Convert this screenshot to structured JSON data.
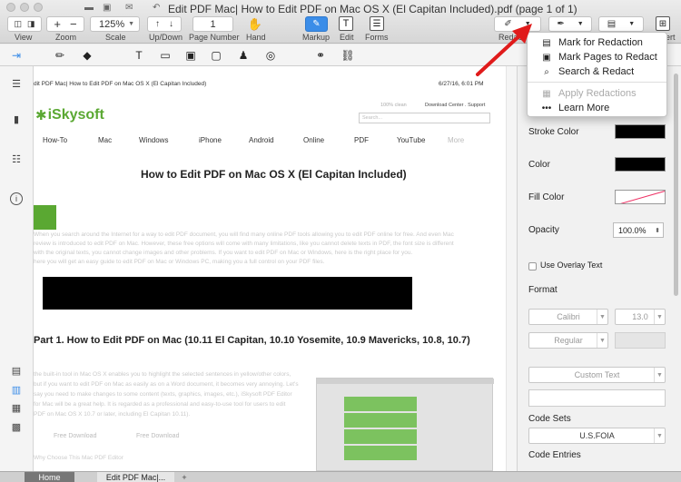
{
  "window": {
    "title": "Edit PDF Mac| How to Edit PDF on Mac OS X (El Capitan Included).pdf (page 1 of 1)"
  },
  "toolbar": {
    "zoom_value": "125%",
    "page_number": "1",
    "labels": {
      "view": "View",
      "zoom": "Zoom",
      "scale": "Scale",
      "updown": "Up/Down",
      "page_number": "Page Number",
      "hand": "Hand",
      "markup": "Markup",
      "edit": "Edit",
      "forms": "Forms",
      "redact": "Redac",
      "insert": "ert"
    }
  },
  "menu": {
    "items": [
      {
        "label": "Mark for Redaction",
        "icon": "mark-redaction-icon",
        "enabled": true
      },
      {
        "label": "Mark Pages to Redact",
        "icon": "mark-pages-icon",
        "enabled": true
      },
      {
        "label": "Search & Redact",
        "icon": "search-redact-icon",
        "enabled": true
      },
      {
        "label": "Apply Redactions",
        "icon": "apply-redactions-icon",
        "enabled": false
      },
      {
        "label": "Learn More",
        "icon": "more-dots-icon",
        "enabled": true
      }
    ]
  },
  "document": {
    "header_left": "dit PDF Mac| How to Edit PDF on Mac OS X (El Capitan Included)",
    "header_right": "6/27/16, 6:01 PM",
    "logo": "iSkysoft",
    "top_links": "Download Center . Support",
    "like_text": "100% clean",
    "search_placeholder": "Search...",
    "nav": [
      "How-To",
      "Mac",
      "Windows",
      "iPhone",
      "Android",
      "Online",
      "PDF",
      "YouTube",
      "More"
    ],
    "heading": "How to Edit PDF on Mac OS X (El Capitan Included)",
    "intro_lines": [
      "When you search around the Internet for a way to edit PDF document, you will find many online PDF tools allowing you to edit PDF online for free. And even Mac",
      "review is introduced to edit PDF on Mac. However, these free options will come with many limitations, like you cannot delete texts in PDF, the font size is different",
      "with the original texts, you cannot change images and other problems. If you want to edit PDF on Mac or Windows, here is the right place for you.",
      "here you will get an easy guide to edit PDF on Mac or Windows PC, making you a full control on your PDF files."
    ],
    "part_heading": "Part 1. How to Edit PDF on Mac (10.11 El Capitan, 10.10 Yosemite, 10.9 Mavericks, 10.8, 10.7)",
    "body_lines": [
      "the built-in tool in Mac OS X enables you to highlight the selected sentences in yellow/other colors,",
      "but if you want to edit PDF on Mac as easily as on a Word document, it becomes very annoying. Let's",
      "say you need to make changes to some content (texts, graphics, images, etc.), iSkysoft PDF Editor",
      "for Mac will be a great help. It is regarded as a professional and easy-to-use tool for users to edit",
      "PDF on Mac OS X 10.7 or later, including El Capitan 10.11)."
    ],
    "free_download_1": "Free Download",
    "free_download_2": "Free Download",
    "why_choose": "Why Choose This Mac PDF Editor"
  },
  "panel": {
    "stroke_color_label": "Stroke Color",
    "color_label": "Color",
    "fill_color_label": "Fill Color",
    "opacity_label": "Opacity",
    "opacity_value": "100.0%",
    "overlay_label": "Use Overlay Text",
    "format_label": "Format",
    "font_value": "Calibri",
    "font_size_value": "13.0",
    "font_style_value": "Regular",
    "custom_text_value": "Custom Text",
    "code_sets_label": "Code Sets",
    "code_sets_value": "U.S.FOIA",
    "code_entries_label": "Code Entries"
  },
  "tabs": {
    "home": "Home",
    "doc": "Edit PDF Mac|...",
    "add": "+"
  },
  "colors": {
    "accent": "#3b8de8",
    "arrow": "#e01b1b",
    "logo_green": "#5aa832"
  }
}
